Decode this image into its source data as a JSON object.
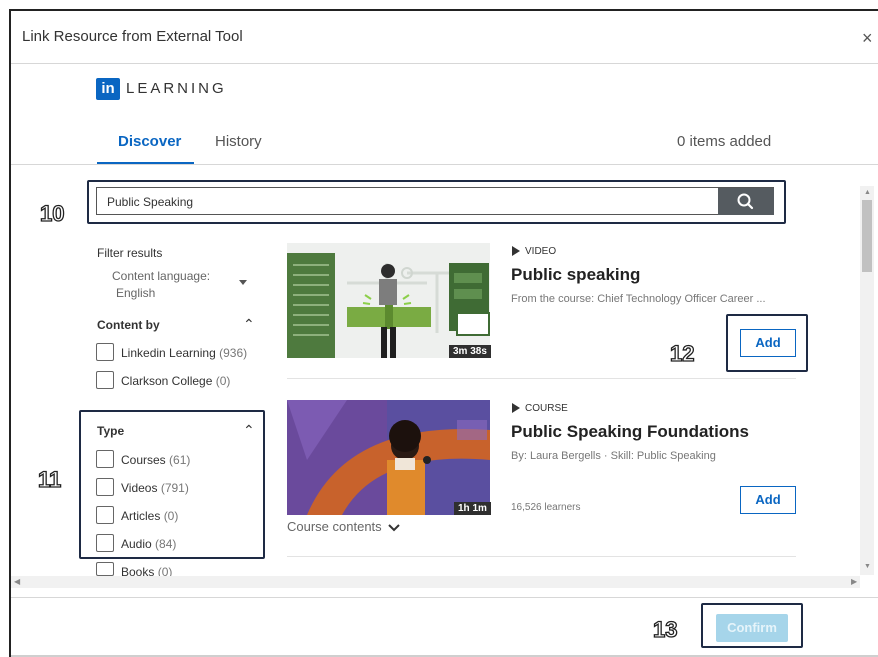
{
  "dialog": {
    "title": "Link Resource from External Tool",
    "close_label": "×"
  },
  "brand": {
    "logo_text": "in",
    "wordmark": "LEARNING",
    "color": "#0a66c2"
  },
  "tabs": [
    {
      "label": "Discover",
      "active": true
    },
    {
      "label": "History",
      "active": false
    }
  ],
  "items_added": "0 items added",
  "search": {
    "value": "Public Speaking",
    "icon": "search-icon"
  },
  "filters": {
    "title": "Filter results",
    "language_label": "Content language:",
    "language_value": "English",
    "content_by": {
      "heading": "Content by",
      "options": [
        {
          "label": "Linkedin Learning",
          "count": "(936)"
        },
        {
          "label": "Clarkson College",
          "count": "(0)"
        }
      ]
    },
    "type": {
      "heading": "Type",
      "options": [
        {
          "label": "Courses",
          "count": "(61)"
        },
        {
          "label": "Videos",
          "count": "(791)"
        },
        {
          "label": "Articles",
          "count": "(0)"
        },
        {
          "label": "Audio",
          "count": "(84)"
        },
        {
          "label": "Books",
          "count": "(0)"
        }
      ]
    }
  },
  "results": [
    {
      "type": "VIDEO",
      "title": "Public speaking",
      "subtitle": "From the course: Chief Technology Officer Career ...",
      "duration": "3m 38s",
      "add_label": "Add"
    },
    {
      "type": "COURSE",
      "title": "Public Speaking Foundations",
      "subtitle": "By: Laura Bergells  ·  Skill: Public Speaking",
      "duration": "1h 1m",
      "learners": "16,526 learners",
      "course_contents": "Course contents",
      "add_label": "Add"
    }
  ],
  "footer": {
    "confirm_label": "Confirm"
  },
  "annotations": [
    "10",
    "11",
    "12",
    "13"
  ]
}
